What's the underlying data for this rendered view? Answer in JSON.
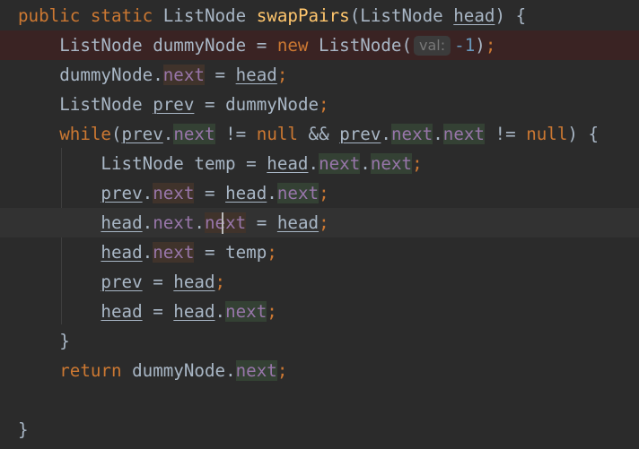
{
  "editor": {
    "theme_colors": {
      "background": "#2b2b2b",
      "text": "#a9b7c6",
      "keyword": "#cc7832",
      "function": "#ffc66d",
      "field": "#9876aa",
      "number": "#6897bb",
      "breakpoint_line": "#3a2323",
      "current_line": "#323232"
    },
    "tokens": {
      "public": "public",
      "static": "static",
      "ListNode": "ListNode",
      "swapPairs": "swapPairs",
      "head": "head",
      "dummyNode": "dummyNode",
      "new": "new",
      "val_hint": "val:",
      "minus_one": "-1",
      "next": "next",
      "prev": "prev",
      "while": "while",
      "null": "null",
      "temp": "temp",
      "return": "return",
      "open_brace": "{",
      "close_brace": "}"
    }
  }
}
